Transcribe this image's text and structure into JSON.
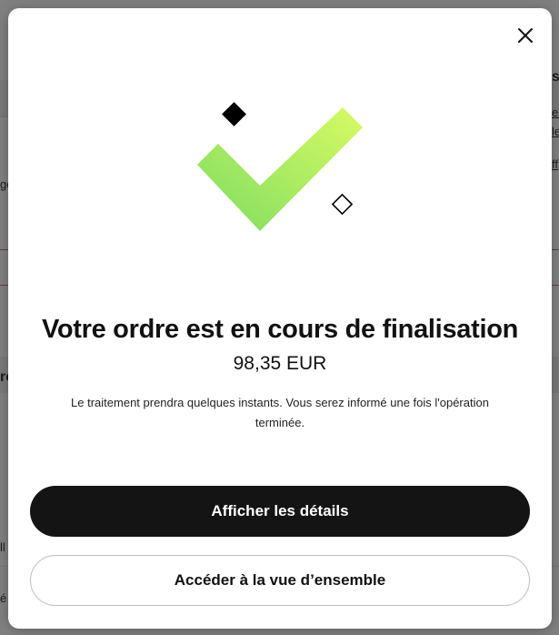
{
  "background": {
    "fragments": [
      {
        "text": "s",
        "style": "bold"
      },
      {
        "text": "er",
        "style": "link"
      },
      {
        "text": "le",
        "style": "link"
      },
      {
        "text": "ff",
        "style": "link"
      },
      {
        "text": "ge",
        "style": "plain"
      },
      {
        "text": "re",
        "style": "bold"
      },
      {
        "text": "ll",
        "style": "plain"
      },
      {
        "text": "é",
        "style": "plain"
      }
    ]
  },
  "modal": {
    "close_label": "×",
    "title": "Votre ordre est en cours de finalisation",
    "amount": "98,35 EUR",
    "message": "Le traitement prendra quelques instants. Vous serez informé une fois l'opération terminée.",
    "primary_button": "Afficher les détails",
    "secondary_button": "Accéder à la vue d’ensemble"
  },
  "colors": {
    "check_gradient_start": "#d8fb63",
    "check_gradient_end": "#7edc62",
    "primary_button_bg": "#141414"
  },
  "icons": {
    "close": "close-icon",
    "hero": "checkmark-icon"
  }
}
